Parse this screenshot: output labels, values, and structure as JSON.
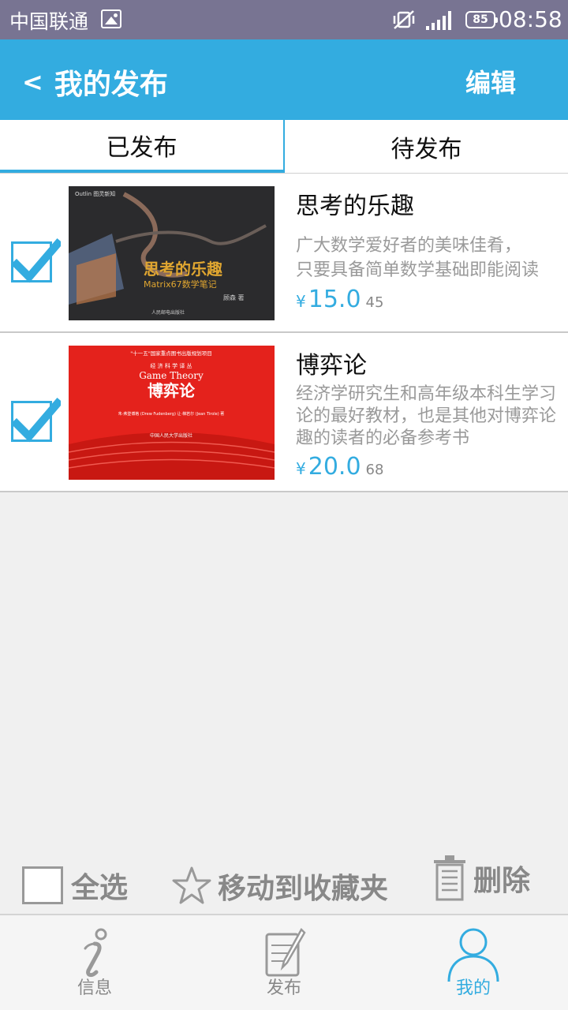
{
  "status_bar": {
    "carrier": "中国联通",
    "battery": "85",
    "time": "08:58"
  },
  "header": {
    "back_label": "<",
    "title": "我的发布",
    "edit_label": "编辑"
  },
  "tabs": [
    {
      "label": "已发布",
      "active": true
    },
    {
      "label": "待发布",
      "active": false
    }
  ],
  "items": [
    {
      "title": "思考的乐趣",
      "desc_lines": [
        "广大数学爱好者的美味佳肴，",
        "只要具备简单数学基础即能阅读"
      ],
      "currency": "¥",
      "price": "15.0",
      "original_price": "45",
      "checked": true,
      "cover": {
        "top_text": "Outlin 图灵新知",
        "title": "思考的乐趣",
        "subtitle": "Matrix67数学笔记",
        "author": "顾森 著",
        "publisher": "人民邮电出版社"
      }
    },
    {
      "title": "博弈论",
      "desc_lines": [
        "经济学研究生和高年级本科生学习",
        "论的最好教材，也是其他对博弈论",
        "趣的读者的必备参考书"
      ],
      "currency": "¥",
      "price": "20.0",
      "original_price": "68",
      "checked": true,
      "cover": {
        "top_text": "\"十一五\"国家重点图书出版规划项目",
        "series": "经 济 科 学 译 丛",
        "en_title": "Game Theory",
        "title": "博弈论",
        "authors": "朱·弗登博格 (Drew Fudenberg)  让·梯若尔 (Jean Tirole)  著",
        "publisher": "中国人民大学出版社"
      }
    }
  ],
  "actions": {
    "select_all": "全选",
    "move_to_favorites": "移动到收藏夹",
    "delete": "删除"
  },
  "nav": [
    {
      "label": "信息",
      "icon": "info-icon",
      "active": false
    },
    {
      "label": "发布",
      "icon": "publish-icon",
      "active": false
    },
    {
      "label": "我的",
      "icon": "user-icon",
      "active": true
    }
  ],
  "colors": {
    "accent": "#33ace0",
    "status_bar": "#787492",
    "cover_red": "#e4221c"
  }
}
